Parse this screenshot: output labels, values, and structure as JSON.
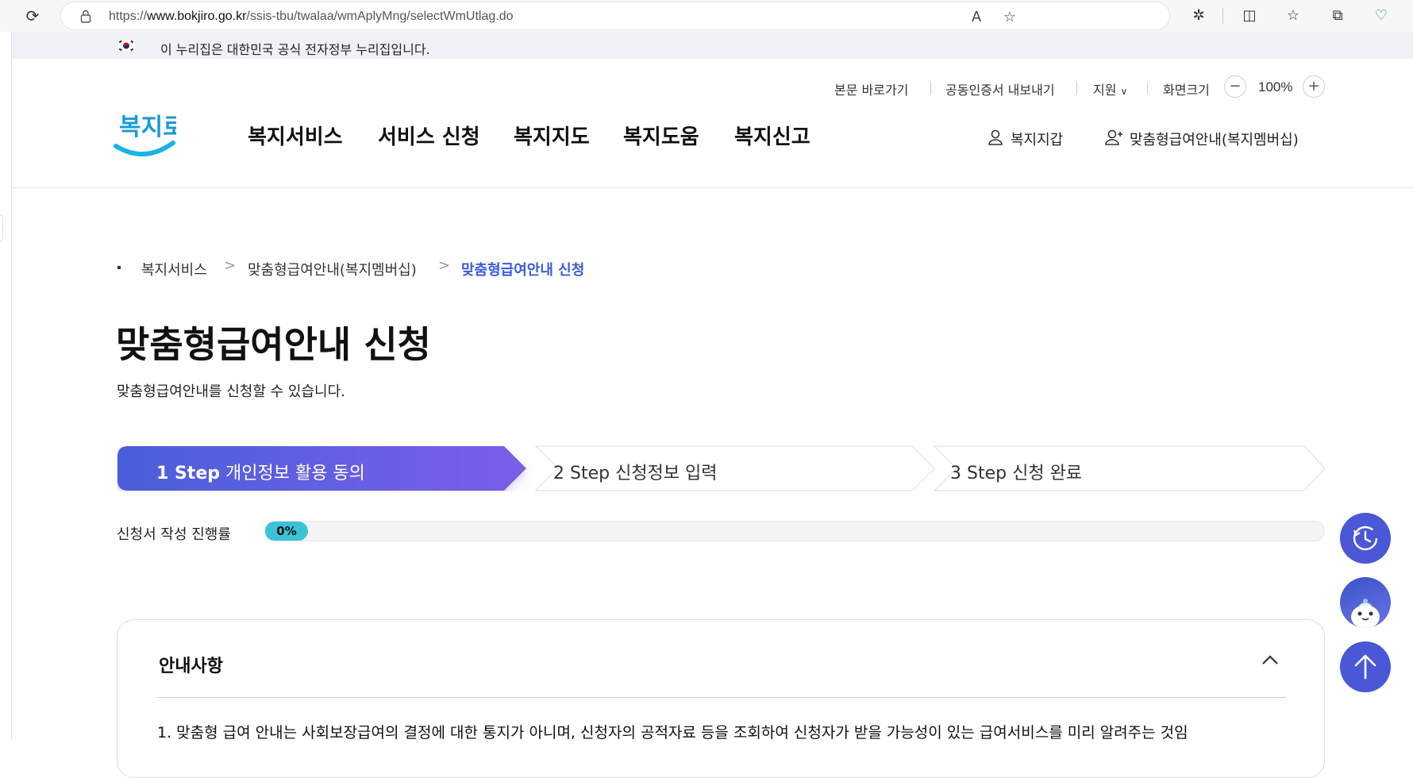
{
  "browser": {
    "url_prefix": "https://",
    "url_domain": "www.bokjiro.go.kr",
    "url_path": "/ssis-tbu/twalaa/wmAplyMng/selectWmUtlag.do"
  },
  "gov_banner": {
    "text": "이 누리집은 대한민국 공식 전자정부 누리집입니다."
  },
  "util_menu": {
    "skip": "본문 바로가기",
    "cert": "공동인증서 내보내기",
    "support": "지원",
    "zoom_label": "화면크기",
    "zoom_minus": "−",
    "zoom_value": "100%",
    "zoom_plus": "+"
  },
  "logo": {
    "text": "복지로"
  },
  "gnb": [
    {
      "label": "복지서비스"
    },
    {
      "label": "서비스 신청"
    },
    {
      "label": "복지지도"
    },
    {
      "label": "복지도움"
    },
    {
      "label": "복지신고"
    }
  ],
  "header_links": {
    "wallet": "복지지갑",
    "membership": "맞춤형급여안내(복지멤버십)"
  },
  "breadcrumb": [
    "복지서비스",
    "맞춤형급여안내(복지멤버십)",
    "맞춤형급여안내 신청"
  ],
  "breadcrumb_sep": ">",
  "page": {
    "title": "맞춤형급여안내 신청",
    "description": "맞춤형급여안내를 신청할 수 있습니다."
  },
  "steps": [
    {
      "num": "1 Step",
      "label": "개인정보 활용 동의",
      "active": true
    },
    {
      "num": "2 Step",
      "label": "신청정보 입력",
      "active": false
    },
    {
      "num": "3 Step",
      "label": "신청 완료",
      "active": false
    }
  ],
  "progress": {
    "label": "신청서 작성 진행률",
    "value_text": "0%",
    "fraction": 0
  },
  "notice": {
    "title": "안내사항",
    "item1": "1. 맞춤형 급여 안내는 사회보장급여의 결정에 대한 통지가 아니며, 신청자의 공적자료 등을 조회하여 신청자가 받을 가능성이 있는 급여서비스를 미리 알려주는 것임"
  },
  "colors": {
    "accent": "#3b5bdb",
    "step_active_start": "#4a5fd9",
    "step_active_end": "#7b5fe8",
    "progress_fill": "#3cc2d6",
    "fab": "#4a57d6",
    "logo_blue": "#1b9ad8"
  },
  "icons": {
    "reload": "reload-icon",
    "lock": "lock-icon",
    "read_aloud": "read-aloud-icon",
    "favorite": "star-icon",
    "extensions": "puzzle-icon",
    "split": "split-screen-icon",
    "favorites_bar": "favorites-icon",
    "collections": "collections-icon",
    "health": "heart-icon",
    "person": "person-icon",
    "person_add": "person-add-icon",
    "history": "history-icon",
    "chatbot": "chatbot-icon",
    "top": "arrow-up-icon",
    "chevron": "chevron-up-icon"
  }
}
